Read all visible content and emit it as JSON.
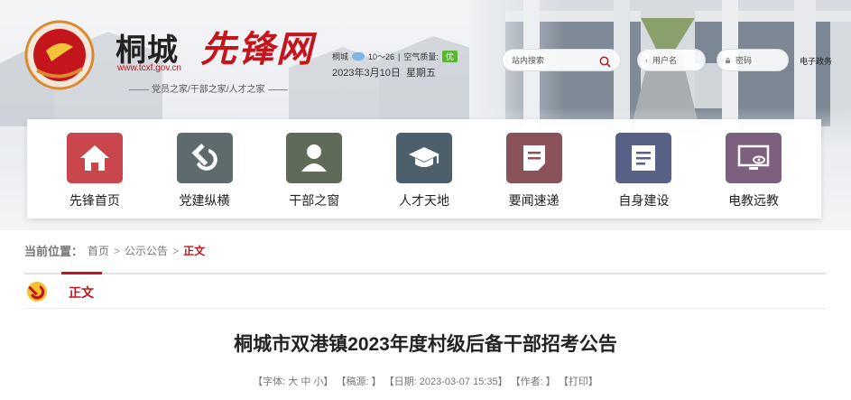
{
  "header": {
    "site_name": "桐城",
    "site_slogan": "先锋网",
    "site_url": "www.tcxf.gov.cn",
    "tagline": "党员之家/干部之家/人才之家",
    "weather": {
      "city": "桐城",
      "temp_range": "10～26",
      "air_quality_label": "空气质量:",
      "air_quality_value": "优",
      "icon": "cloud-icon"
    },
    "date": "2023年3月10日",
    "weekday": "星期五",
    "search": {
      "placeholder": "站内搜索",
      "icon": "search-icon"
    },
    "login": {
      "username_placeholder": "用户名",
      "password_placeholder": "密码",
      "e_gov_link": "电子政务"
    }
  },
  "nav": {
    "items": [
      {
        "label": "先锋首页",
        "icon": "home-icon",
        "color": "#c9464c"
      },
      {
        "label": "党建纵横",
        "icon": "hammer-sickle-icon",
        "color": "#5e6b6c"
      },
      {
        "label": "干部之窗",
        "icon": "user-icon",
        "color": "#5f6b58"
      },
      {
        "label": "人才天地",
        "icon": "graduation-cap-icon",
        "color": "#4d5f6b"
      },
      {
        "label": "要闻速递",
        "icon": "document-icon",
        "color": "#8a5359"
      },
      {
        "label": "自身建设",
        "icon": "notebook-icon",
        "color": "#576085"
      },
      {
        "label": "电教远教",
        "icon": "monitor-icon",
        "color": "#7c607d"
      }
    ]
  },
  "breadcrumb": {
    "title": "当前位置：",
    "items": [
      "首页",
      "公示公告"
    ],
    "separator": ">",
    "current": "正文"
  },
  "section": {
    "title": "正文",
    "emblem": "party-emblem-icon"
  },
  "article": {
    "title": "桐城市双港镇2023年度村级后备干部招考公告",
    "meta": {
      "font_label": "【字体:",
      "font_large": "大",
      "font_medium": "中",
      "font_small": "小】",
      "source": "【稿源: 】",
      "date": "【日期: 2023-03-07 15:35】",
      "author": "【作者: 】",
      "print": "【打印】"
    }
  },
  "colors": {
    "brand_red": "#c4141c",
    "aq_green": "#5cb531"
  }
}
